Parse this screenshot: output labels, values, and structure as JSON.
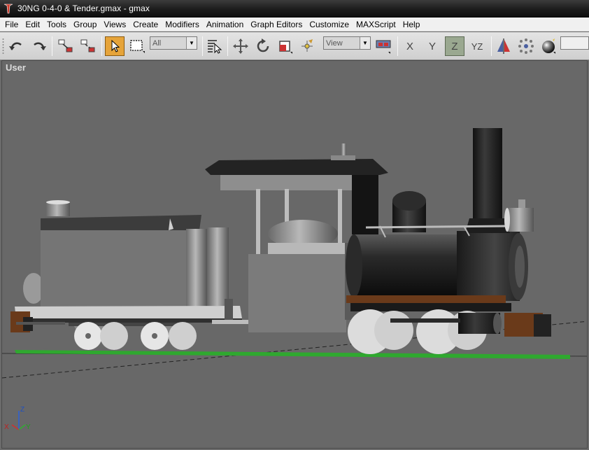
{
  "window": {
    "title": "30NG 0-4-0 & Tender.gmax - gmax"
  },
  "menu": {
    "items": [
      "File",
      "Edit",
      "Tools",
      "Group",
      "Views",
      "Create",
      "Modifiers",
      "Animation",
      "Graph Editors",
      "Customize",
      "MAXScript",
      "Help"
    ]
  },
  "toolbar": {
    "selection_filter": "All",
    "reference_coord": "View",
    "axis_x": "X",
    "axis_y": "Y",
    "axis_z": "Z",
    "axis_yz": "YZ",
    "selection_set": ""
  },
  "viewport": {
    "label": "User",
    "gizmo_z": "Z",
    "gizmo_x": "X",
    "gizmo_y": "Y"
  },
  "colors": {
    "viewport_bg": "#686868",
    "active_tool": "#e6a43a",
    "active_axis": "#9aa890",
    "track_green": "#2fa82f"
  }
}
